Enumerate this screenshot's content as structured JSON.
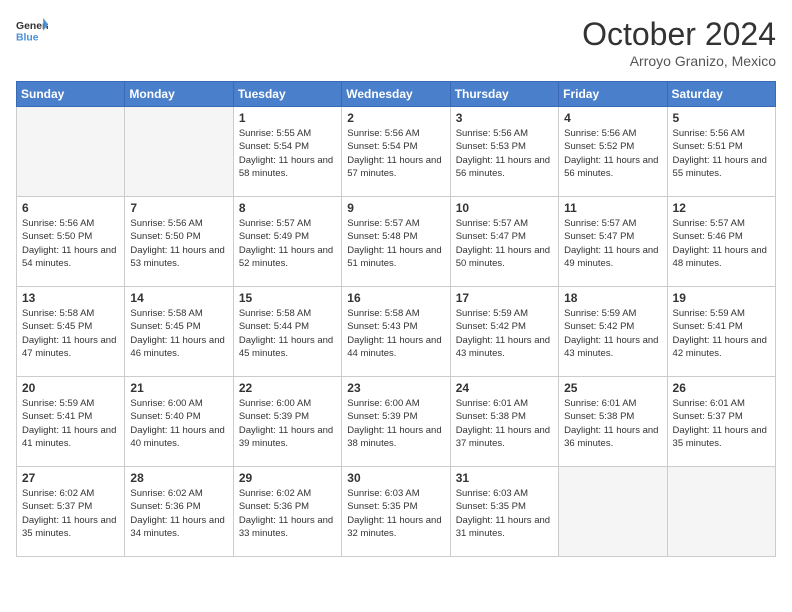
{
  "header": {
    "logo_line1": "General",
    "logo_line2": "Blue",
    "month": "October 2024",
    "location": "Arroyo Granizo, Mexico"
  },
  "days_of_week": [
    "Sunday",
    "Monday",
    "Tuesday",
    "Wednesday",
    "Thursday",
    "Friday",
    "Saturday"
  ],
  "weeks": [
    [
      {
        "day": "",
        "empty": true
      },
      {
        "day": "",
        "empty": true
      },
      {
        "day": "1",
        "sunrise": "5:55 AM",
        "sunset": "5:54 PM",
        "daylight": "11 hours and 58 minutes."
      },
      {
        "day": "2",
        "sunrise": "5:56 AM",
        "sunset": "5:54 PM",
        "daylight": "11 hours and 57 minutes."
      },
      {
        "day": "3",
        "sunrise": "5:56 AM",
        "sunset": "5:53 PM",
        "daylight": "11 hours and 56 minutes."
      },
      {
        "day": "4",
        "sunrise": "5:56 AM",
        "sunset": "5:52 PM",
        "daylight": "11 hours and 56 minutes."
      },
      {
        "day": "5",
        "sunrise": "5:56 AM",
        "sunset": "5:51 PM",
        "daylight": "11 hours and 55 minutes."
      }
    ],
    [
      {
        "day": "6",
        "sunrise": "5:56 AM",
        "sunset": "5:50 PM",
        "daylight": "11 hours and 54 minutes."
      },
      {
        "day": "7",
        "sunrise": "5:56 AM",
        "sunset": "5:50 PM",
        "daylight": "11 hours and 53 minutes."
      },
      {
        "day": "8",
        "sunrise": "5:57 AM",
        "sunset": "5:49 PM",
        "daylight": "11 hours and 52 minutes."
      },
      {
        "day": "9",
        "sunrise": "5:57 AM",
        "sunset": "5:48 PM",
        "daylight": "11 hours and 51 minutes."
      },
      {
        "day": "10",
        "sunrise": "5:57 AM",
        "sunset": "5:47 PM",
        "daylight": "11 hours and 50 minutes."
      },
      {
        "day": "11",
        "sunrise": "5:57 AM",
        "sunset": "5:47 PM",
        "daylight": "11 hours and 49 minutes."
      },
      {
        "day": "12",
        "sunrise": "5:57 AM",
        "sunset": "5:46 PM",
        "daylight": "11 hours and 48 minutes."
      }
    ],
    [
      {
        "day": "13",
        "sunrise": "5:58 AM",
        "sunset": "5:45 PM",
        "daylight": "11 hours and 47 minutes."
      },
      {
        "day": "14",
        "sunrise": "5:58 AM",
        "sunset": "5:45 PM",
        "daylight": "11 hours and 46 minutes."
      },
      {
        "day": "15",
        "sunrise": "5:58 AM",
        "sunset": "5:44 PM",
        "daylight": "11 hours and 45 minutes."
      },
      {
        "day": "16",
        "sunrise": "5:58 AM",
        "sunset": "5:43 PM",
        "daylight": "11 hours and 44 minutes."
      },
      {
        "day": "17",
        "sunrise": "5:59 AM",
        "sunset": "5:42 PM",
        "daylight": "11 hours and 43 minutes."
      },
      {
        "day": "18",
        "sunrise": "5:59 AM",
        "sunset": "5:42 PM",
        "daylight": "11 hours and 43 minutes."
      },
      {
        "day": "19",
        "sunrise": "5:59 AM",
        "sunset": "5:41 PM",
        "daylight": "11 hours and 42 minutes."
      }
    ],
    [
      {
        "day": "20",
        "sunrise": "5:59 AM",
        "sunset": "5:41 PM",
        "daylight": "11 hours and 41 minutes."
      },
      {
        "day": "21",
        "sunrise": "6:00 AM",
        "sunset": "5:40 PM",
        "daylight": "11 hours and 40 minutes."
      },
      {
        "day": "22",
        "sunrise": "6:00 AM",
        "sunset": "5:39 PM",
        "daylight": "11 hours and 39 minutes."
      },
      {
        "day": "23",
        "sunrise": "6:00 AM",
        "sunset": "5:39 PM",
        "daylight": "11 hours and 38 minutes."
      },
      {
        "day": "24",
        "sunrise": "6:01 AM",
        "sunset": "5:38 PM",
        "daylight": "11 hours and 37 minutes."
      },
      {
        "day": "25",
        "sunrise": "6:01 AM",
        "sunset": "5:38 PM",
        "daylight": "11 hours and 36 minutes."
      },
      {
        "day": "26",
        "sunrise": "6:01 AM",
        "sunset": "5:37 PM",
        "daylight": "11 hours and 35 minutes."
      }
    ],
    [
      {
        "day": "27",
        "sunrise": "6:02 AM",
        "sunset": "5:37 PM",
        "daylight": "11 hours and 35 minutes."
      },
      {
        "day": "28",
        "sunrise": "6:02 AM",
        "sunset": "5:36 PM",
        "daylight": "11 hours and 34 minutes."
      },
      {
        "day": "29",
        "sunrise": "6:02 AM",
        "sunset": "5:36 PM",
        "daylight": "11 hours and 33 minutes."
      },
      {
        "day": "30",
        "sunrise": "6:03 AM",
        "sunset": "5:35 PM",
        "daylight": "11 hours and 32 minutes."
      },
      {
        "day": "31",
        "sunrise": "6:03 AM",
        "sunset": "5:35 PM",
        "daylight": "11 hours and 31 minutes."
      },
      {
        "day": "",
        "empty": true
      },
      {
        "day": "",
        "empty": true
      }
    ]
  ]
}
